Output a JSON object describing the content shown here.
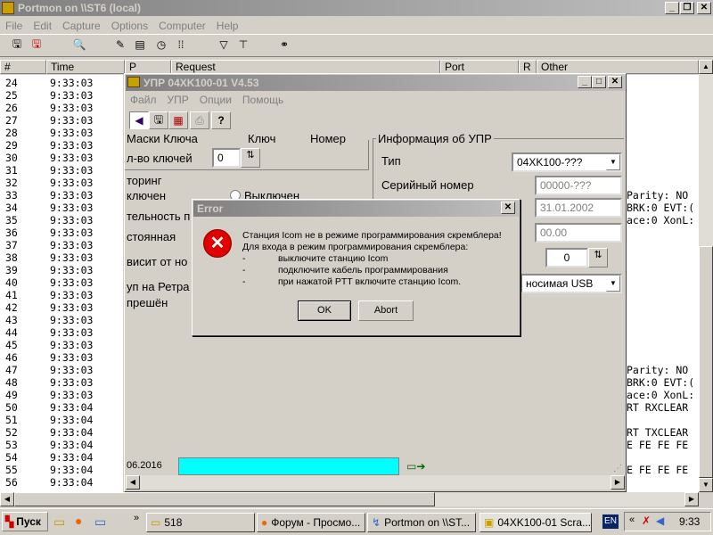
{
  "portmon": {
    "title": "Portmon on \\\\ST6 (local)",
    "menu": [
      "File",
      "Edit",
      "Capture",
      "Options",
      "Computer",
      "Help"
    ],
    "columns": [
      "#",
      "Time",
      "P",
      "Request",
      "Port",
      "R",
      "Other"
    ],
    "rows": [
      {
        "n": "24",
        "t": "9:33:03"
      },
      {
        "n": "25",
        "t": "9:33:03"
      },
      {
        "n": "26",
        "t": "9:33:03"
      },
      {
        "n": "27",
        "t": "9:33:03"
      },
      {
        "n": "28",
        "t": "9:33:03"
      },
      {
        "n": "29",
        "t": "9:33:03"
      },
      {
        "n": "30",
        "t": "9:33:03"
      },
      {
        "n": "31",
        "t": "9:33:03"
      },
      {
        "n": "32",
        "t": "9:33:03"
      },
      {
        "n": "33",
        "t": "9:33:03"
      },
      {
        "n": "34",
        "t": "9:33:03"
      },
      {
        "n": "35",
        "t": "9:33:03"
      },
      {
        "n": "36",
        "t": "9:33:03"
      },
      {
        "n": "37",
        "t": "9:33:03"
      },
      {
        "n": "38",
        "t": "9:33:03"
      },
      {
        "n": "39",
        "t": "9:33:03"
      },
      {
        "n": "40",
        "t": "9:33:03"
      },
      {
        "n": "41",
        "t": "9:33:03"
      },
      {
        "n": "42",
        "t": "9:33:03"
      },
      {
        "n": "43",
        "t": "9:33:03"
      },
      {
        "n": "44",
        "t": "9:33:03"
      },
      {
        "n": "45",
        "t": "9:33:03"
      },
      {
        "n": "46",
        "t": "9:33:03"
      },
      {
        "n": "47",
        "t": "9:33:03"
      },
      {
        "n": "48",
        "t": "9:33:03"
      },
      {
        "n": "49",
        "t": "9:33:03"
      },
      {
        "n": "50",
        "t": "9:33:04"
      },
      {
        "n": "51",
        "t": "9:33:04"
      },
      {
        "n": "52",
        "t": "9:33:04"
      },
      {
        "n": "53",
        "t": "9:33:04"
      },
      {
        "n": "54",
        "t": "9:33:04"
      },
      {
        "n": "55",
        "t": "9:33:04"
      },
      {
        "n": "56",
        "t": "9:33:04"
      }
    ],
    "other_lines": [
      {
        "row": 9,
        "text": "Parity: NO"
      },
      {
        "row": 10,
        "text": "BRK:0 EVT:("
      },
      {
        "row": 11,
        "text": "ace:0 XonL:"
      },
      {
        "row": 23,
        "text": "Parity: NO"
      },
      {
        "row": 24,
        "text": "BRK:0 EVT:("
      },
      {
        "row": 25,
        "text": "ace:0 XonL:"
      },
      {
        "row": 26,
        "text": "RT RXCLEAR"
      },
      {
        "row": 28,
        "text": "RT TXCLEAR"
      },
      {
        "row": 29,
        "text": "E FE FE FE"
      },
      {
        "row": 31,
        "text": "E FE FE FE"
      }
    ]
  },
  "upr": {
    "title": "УПР 04XK100-01    V4.53",
    "menu": [
      "Файл",
      "УПР",
      "Опции",
      "Помощь"
    ],
    "keys_header": {
      "masks": "Маски Ключа",
      "key": "Ключ",
      "number": "Номер"
    },
    "keys_count_label": "л-во ключей",
    "keys_count_value": "0",
    "monitoring_label": "торинг",
    "on_label": "ключен",
    "off_label": "Выключен",
    "duration_label": "тельность п",
    "constant_label": "стоянная",
    "depends_label": "висит от но",
    "relay_label": "уп на Ретра",
    "allowed_label": "прешён",
    "info_title": "Информация об УПР",
    "type_label": "Тип",
    "type_value": "04XK100-???",
    "serial_label": "Серийный номер",
    "serial_value": "00000-???",
    "date_value": "31.01.2002",
    "version_value": "00.00",
    "spin_value": "0",
    "usb_value": "носимая USB",
    "status_date": "06.2016"
  },
  "dialog": {
    "title": "Error",
    "line1": "Станция Icom не в режиме программирования скремблера!",
    "line2": "Для входа в режим программирования скремблера:",
    "items": [
      {
        "dash": "-",
        "text": "выключите станцию Icom"
      },
      {
        "dash": "-",
        "text": "подключите кабель программирования"
      },
      {
        "dash": "-",
        "text": "при нажатой PTT включите станцию Icom."
      }
    ],
    "ok": "OK",
    "abort": "Abort"
  },
  "taskbar": {
    "start": "Пуск",
    "buttons": [
      "518",
      "Форум - Просмо...",
      "Portmon on \\\\ST...",
      "04XK100-01 Scra..."
    ],
    "lang": "EN",
    "clock": "9:33"
  }
}
